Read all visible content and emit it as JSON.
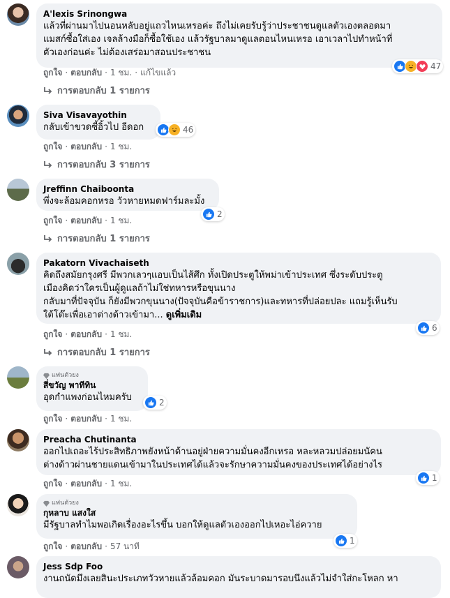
{
  "colors": {
    "bubble": "#f0f2f5",
    "secondary": "#65676b",
    "like_blue": "#1877f2",
    "haha_yellow": "#f7b125",
    "love_red": "#f33e58"
  },
  "comments": [
    {
      "name": "A'lexis Srinongwa",
      "lines": [
        "แล้วที่ผ่านมาไปนอนหลับอยู่แถวไหนเหรอค่ะ ถึงไม่เคยรับรู้ว่าประชาชนดูแลตัวเองตลอดมา",
        "แมสก์ซื้อใส่เอง เจลล้างมือก็ซื้อใช้เอง แล้วรัฐบาลมาดูแลตอนไหนเหรอ เอาเวลาไปทำหน้าที่",
        "ตัวเองก่อนค่ะ ไม่ต้องเสร่อมาสอนประชาชน"
      ],
      "like": "ถูกใจ",
      "reply": "ตอบกลับ",
      "time": "1 ชม.",
      "edited": "แก้ไขแล้ว",
      "reaction_count": "47",
      "replies_label": "การตอบกลับ 1 รายการ"
    },
    {
      "name": "Siva Visavayothin",
      "lines": [
        "กลับเข้าขวดซี้อิ้วไป อีดอก"
      ],
      "like": "ถูกใจ",
      "reply": "ตอบกลับ",
      "time": "1 ชม.",
      "reaction_count": "46",
      "replies_label": "การตอบกลับ 3 รายการ"
    },
    {
      "name": "Jreffinn Chaiboonta",
      "lines": [
        "พึ่งจะล้อมคอกหรอ วัวหายหมดฟาร์มละมั้ง"
      ],
      "like": "ถูกใจ",
      "reply": "ตอบกลับ",
      "time": "1 ชม.",
      "reaction_count": "2",
      "replies_label": "การตอบกลับ 1 รายการ"
    },
    {
      "name": "Pakatorn Vivachaiseth",
      "lines": [
        "คิดถึงสมัยกรุงศรี มีพวกเลวๆแอบเป็นไส้ศึก ทั้งเปิดประตูให้พม่าเข้าประเทศ ซึ่งระดับประตู",
        "เมืองคิดว่าใครเป็นผู้ดูแลถ้าไม่ใช่ทหารหรือขุนนาง",
        "กลับมาที่ปัจจุบัน ก็ยังมีพวกขุนนาง(ปัจจุบันคือข้าราชการ)และทหารที่ปล่อยปละ แถมรู้เห็นรับ",
        "ใต้โต๊ะเพื่อเอาต่างด้าวเข้ามา..."
      ],
      "see_more": "ดูเพิ่มเติม",
      "like": "ถูกใจ",
      "reply": "ตอบกลับ",
      "time": "1 ชม.",
      "reaction_count": "6",
      "replies_label": "การตอบกลับ 1 รายการ"
    },
    {
      "badge": "แฟนตัวยง",
      "name": "สี่ขวัญ พาทีทิน",
      "lines": [
        "อุดกำแพงก่อนไหมครับ"
      ],
      "like": "ถูกใจ",
      "reply": "ตอบกลับ",
      "time": "1 ชม.",
      "reaction_count": "2"
    },
    {
      "name": "Preacha Chutinanta",
      "lines": [
        "ออกไปเถอะไร้ประสิทธิภาพยังหน้าด้านอยู่ฝ่ายความมั่นคงอีกเหรอ หละหลวมปล่อยมนัคน",
        "ต่างด้าวผ่านชายแดนเข้ามาในประเทศได้แล้วจะรักษาความมั่นคงของประเทศได้อย่างไร"
      ],
      "like": "ถูกใจ",
      "reply": "ตอบกลับ",
      "time": "1 ชม.",
      "reaction_count": "1"
    },
    {
      "badge": "แฟนตัวยง",
      "name": "กุหลาบ แสงใส",
      "lines": [
        "มีรัฐบาลทำไมพอเกิดเรื่องอะไรขึ้น บอกให้ดูแลตัวเองออกไปเหอะไอ่ควาย"
      ],
      "like": "ถูกใจ",
      "reply": "ตอบกลับ",
      "time": "57 นาที",
      "reaction_count": "1"
    },
    {
      "name": "Jess Sdp Foo",
      "lines": [
        "งานถนัดมึงเลยสินะประเภทวัวหายแล้วล้อมคอก มันระบาดมารอบนึงแล้วไม่จำใส่กะโหลก หา"
      ]
    }
  ]
}
